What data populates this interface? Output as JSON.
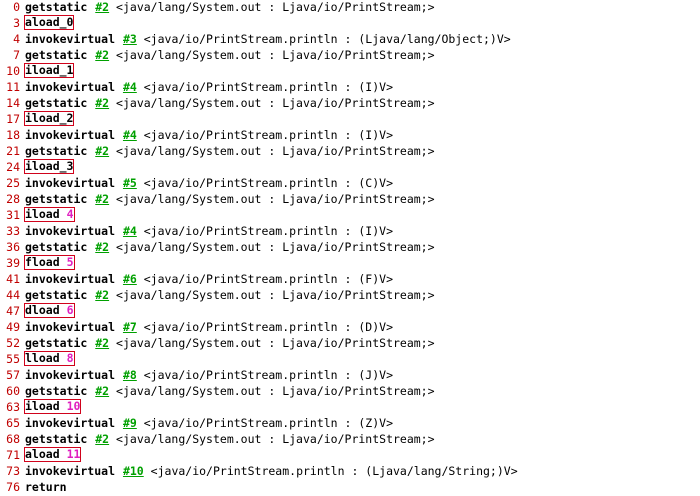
{
  "colors": {
    "line_number": "#c00000",
    "ref_link": "#00a000",
    "local_index": "#e020c0",
    "highlight_box": "#d0021b"
  },
  "lines": [
    {
      "num": "0",
      "op": "getstatic",
      "arg": "",
      "ref": "#2",
      "comment": "<java/lang/System.out : Ljava/io/PrintStream;>",
      "boxed": false
    },
    {
      "num": "3",
      "op": "aload_0",
      "arg": "",
      "ref": "",
      "comment": "",
      "boxed": true
    },
    {
      "num": "4",
      "op": "invokevirtual",
      "arg": "",
      "ref": "#3",
      "comment": "<java/io/PrintStream.println : (Ljava/lang/Object;)V>",
      "boxed": false
    },
    {
      "num": "7",
      "op": "getstatic",
      "arg": "",
      "ref": "#2",
      "comment": "<java/lang/System.out : Ljava/io/PrintStream;>",
      "boxed": false
    },
    {
      "num": "10",
      "op": "iload_1",
      "arg": "",
      "ref": "",
      "comment": "",
      "boxed": true
    },
    {
      "num": "11",
      "op": "invokevirtual",
      "arg": "",
      "ref": "#4",
      "comment": "<java/io/PrintStream.println : (I)V>",
      "boxed": false
    },
    {
      "num": "14",
      "op": "getstatic",
      "arg": "",
      "ref": "#2",
      "comment": "<java/lang/System.out : Ljava/io/PrintStream;>",
      "boxed": false
    },
    {
      "num": "17",
      "op": "iload_2",
      "arg": "",
      "ref": "",
      "comment": "",
      "boxed": true
    },
    {
      "num": "18",
      "op": "invokevirtual",
      "arg": "",
      "ref": "#4",
      "comment": "<java/io/PrintStream.println : (I)V>",
      "boxed": false
    },
    {
      "num": "21",
      "op": "getstatic",
      "arg": "",
      "ref": "#2",
      "comment": "<java/lang/System.out : Ljava/io/PrintStream;>",
      "boxed": false
    },
    {
      "num": "24",
      "op": "iload_3",
      "arg": "",
      "ref": "",
      "comment": "",
      "boxed": true
    },
    {
      "num": "25",
      "op": "invokevirtual",
      "arg": "",
      "ref": "#5",
      "comment": "<java/io/PrintStream.println : (C)V>",
      "boxed": false
    },
    {
      "num": "28",
      "op": "getstatic",
      "arg": "",
      "ref": "#2",
      "comment": "<java/lang/System.out : Ljava/io/PrintStream;>",
      "boxed": false
    },
    {
      "num": "31",
      "op": "iload",
      "arg": "4",
      "ref": "",
      "comment": "",
      "boxed": true
    },
    {
      "num": "33",
      "op": "invokevirtual",
      "arg": "",
      "ref": "#4",
      "comment": "<java/io/PrintStream.println : (I)V>",
      "boxed": false
    },
    {
      "num": "36",
      "op": "getstatic",
      "arg": "",
      "ref": "#2",
      "comment": "<java/lang/System.out : Ljava/io/PrintStream;>",
      "boxed": false
    },
    {
      "num": "39",
      "op": "fload",
      "arg": "5",
      "ref": "",
      "comment": "",
      "boxed": true
    },
    {
      "num": "41",
      "op": "invokevirtual",
      "arg": "",
      "ref": "#6",
      "comment": "<java/io/PrintStream.println : (F)V>",
      "boxed": false
    },
    {
      "num": "44",
      "op": "getstatic",
      "arg": "",
      "ref": "#2",
      "comment": "<java/lang/System.out : Ljava/io/PrintStream;>",
      "boxed": false
    },
    {
      "num": "47",
      "op": "dload",
      "arg": "6",
      "ref": "",
      "comment": "",
      "boxed": true
    },
    {
      "num": "49",
      "op": "invokevirtual",
      "arg": "",
      "ref": "#7",
      "comment": "<java/io/PrintStream.println : (D)V>",
      "boxed": false
    },
    {
      "num": "52",
      "op": "getstatic",
      "arg": "",
      "ref": "#2",
      "comment": "<java/lang/System.out : Ljava/io/PrintStream;>",
      "boxed": false
    },
    {
      "num": "55",
      "op": "lload",
      "arg": "8",
      "ref": "",
      "comment": "",
      "boxed": true
    },
    {
      "num": "57",
      "op": "invokevirtual",
      "arg": "",
      "ref": "#8",
      "comment": "<java/io/PrintStream.println : (J)V>",
      "boxed": false
    },
    {
      "num": "60",
      "op": "getstatic",
      "arg": "",
      "ref": "#2",
      "comment": "<java/lang/System.out : Ljava/io/PrintStream;>",
      "boxed": false
    },
    {
      "num": "63",
      "op": "iload",
      "arg": "10",
      "ref": "",
      "comment": "",
      "boxed": true
    },
    {
      "num": "65",
      "op": "invokevirtual",
      "arg": "",
      "ref": "#9",
      "comment": "<java/io/PrintStream.println : (Z)V>",
      "boxed": false
    },
    {
      "num": "68",
      "op": "getstatic",
      "arg": "",
      "ref": "#2",
      "comment": "<java/lang/System.out : Ljava/io/PrintStream;>",
      "boxed": false
    },
    {
      "num": "71",
      "op": "aload",
      "arg": "11",
      "ref": "",
      "comment": "",
      "boxed": true
    },
    {
      "num": "73",
      "op": "invokevirtual",
      "arg": "",
      "ref": "#10",
      "comment": "<java/io/PrintStream.println : (Ljava/lang/String;)V>",
      "boxed": false
    },
    {
      "num": "76",
      "op": "return",
      "arg": "",
      "ref": "",
      "comment": "",
      "boxed": false
    }
  ]
}
